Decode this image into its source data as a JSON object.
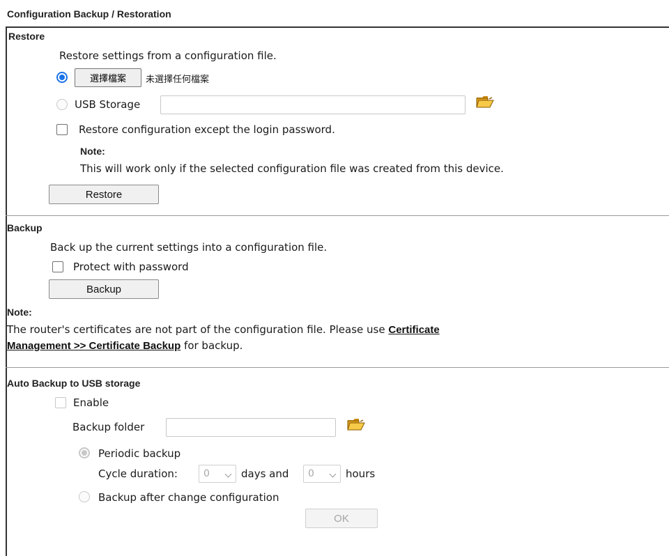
{
  "page_title": "Configuration Backup / Restoration",
  "restore": {
    "heading": "Restore",
    "description": "Restore settings from a configuration file.",
    "file_button_label": "選擇檔案",
    "file_status": "未選擇任何檔案",
    "usb_storage_label": "USB Storage",
    "usb_storage_value": "",
    "except_password_label": "Restore configuration except the login password.",
    "note_heading": "Note:",
    "note_text": "This will work only if the selected configuration file was created from this device.",
    "restore_button": "Restore"
  },
  "backup": {
    "heading": "Backup",
    "description": "Back up the current settings into a configuration file.",
    "protect_label": "Protect with password",
    "backup_button": "Backup",
    "note_heading": "Note:",
    "note_text_before": "The router's certificates are not part of the configuration file. Please use ",
    "note_link_line1": "Certificate",
    "note_link_line2": "Management >> Certificate Backup",
    "note_text_after": " for backup."
  },
  "auto_backup": {
    "heading": "Auto Backup to USB storage",
    "enable_label": "Enable",
    "folder_label": "Backup folder",
    "folder_value": "",
    "periodic_label": "Periodic backup",
    "cycle_label": "Cycle duration:",
    "days_value": "0",
    "days_label": "days and",
    "hours_value": "0",
    "hours_label": "hours",
    "after_change_label": "Backup after change configuration",
    "ok_button": "OK"
  },
  "colors": {
    "accent_radio": "#1a73e8",
    "folder_icon": "#f0b429"
  }
}
